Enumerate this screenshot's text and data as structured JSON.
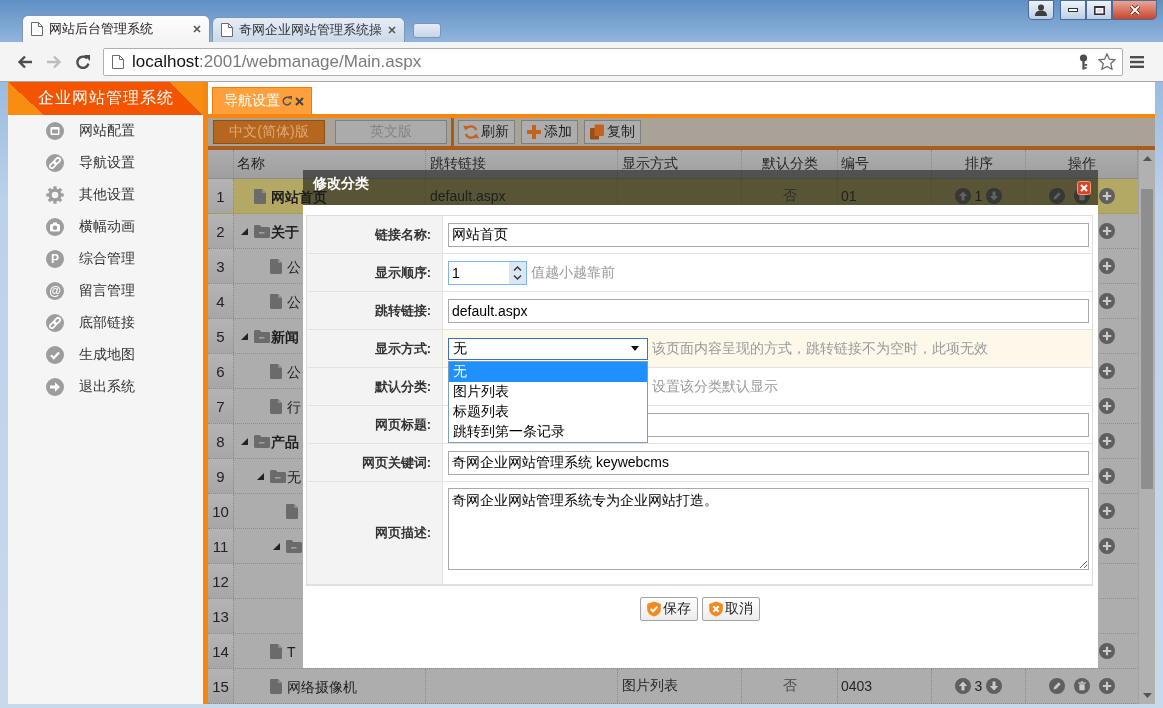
{
  "browser": {
    "tabs": [
      {
        "title": "网站后台管理系统",
        "selected": true
      },
      {
        "title": "奇网企业网站管理系统操",
        "selected": false
      }
    ],
    "nav": [
      {
        "kind": "back",
        "disabled": false
      },
      {
        "kind": "forward",
        "disabled": true
      },
      {
        "kind": "reload",
        "disabled": false
      }
    ],
    "address": {
      "host": "localhost",
      "path": ":2001/webmanage/Main.aspx"
    }
  },
  "sidebar": {
    "title": "企业网站管理系统",
    "items": [
      {
        "label": "网站配置",
        "kind": "window"
      },
      {
        "label": "导航设置",
        "kind": "link"
      },
      {
        "label": "其他设置",
        "kind": "gear"
      },
      {
        "label": "横幅动画",
        "kind": "camera"
      },
      {
        "label": "综合管理",
        "kind": "letter",
        "glyph": "P"
      },
      {
        "label": "留言管理",
        "kind": "at",
        "glyph": "@"
      },
      {
        "label": "底部链接",
        "kind": "link"
      },
      {
        "label": "生成地图",
        "kind": "check"
      },
      {
        "label": "退出系统",
        "kind": "arrow"
      }
    ]
  },
  "page_tabs": [
    {
      "label": "导航设置",
      "selected": true
    }
  ],
  "toolbar": {
    "languages": [
      {
        "label": "中文(简体)版",
        "selected": true
      },
      {
        "label": "英文版",
        "selected": false
      }
    ],
    "buttons": [
      {
        "label": "刷新",
        "kind": "refresh"
      },
      {
        "label": "添加",
        "kind": "add"
      },
      {
        "label": "复制",
        "kind": "copy"
      }
    ]
  },
  "table": {
    "columns": [
      "名称",
      "跳转链接",
      "显示方式",
      "默认分类",
      "编号",
      "排序",
      "操作"
    ],
    "rows": [
      {
        "number": "1",
        "kind": "file",
        "name": "网站首页",
        "selected": true,
        "link": "default.aspx",
        "default": "否",
        "code": "01",
        "order": "1",
        "actions": [
          {
            "kind": "edit"
          },
          {
            "kind": "delete"
          },
          {
            "kind": "add"
          }
        ]
      },
      {
        "number": "2",
        "kind": "folder",
        "expanded": true,
        "name": "关于",
        "selected": false,
        "actions": [
          {
            "kind": "add"
          }
        ],
        "children": [
          {
            "number": "3",
            "kind": "file",
            "name": "公",
            "selected": false,
            "actions": [
              {
                "kind": "add"
              }
            ]
          },
          {
            "number": "4",
            "kind": "file",
            "name": "公",
            "selected": false,
            "actions": [
              {
                "kind": "add"
              }
            ]
          }
        ]
      },
      {
        "number": "5",
        "kind": "folder",
        "expanded": true,
        "name": "新闻",
        "selected": false,
        "actions": [
          {
            "kind": "add"
          }
        ],
        "children": [
          {
            "number": "6",
            "kind": "file",
            "name": "公",
            "selected": false,
            "actions": [
              {
                "kind": "add"
              }
            ]
          },
          {
            "number": "7",
            "kind": "file",
            "name": "行",
            "selected": false,
            "actions": [
              {
                "kind": "add"
              }
            ]
          }
        ]
      },
      {
        "number": "8",
        "kind": "folder",
        "expanded": true,
        "name": "产品",
        "selected": false,
        "actions": [
          {
            "kind": "add"
          }
        ],
        "children": [
          {
            "number": "9",
            "kind": "folder",
            "expanded": true,
            "name": "无",
            "selected": false,
            "actions": [
              {
                "kind": "add"
              }
            ],
            "children": [
              {
                "number": "10",
                "kind": "file",
                "selected": false,
                "actions": [
                  {
                    "kind": "add"
                  }
                ]
              },
              {
                "number": "11",
                "kind": "folder",
                "expanded": true,
                "selected": false,
                "actions": [
                  {
                    "kind": "add"
                  }
                ],
                "children": [
                  {
                    "number": "12",
                    "selected": false
                  },
                  {
                    "number": "13",
                    "selected": false
                  }
                ]
              }
            ]
          },
          {
            "number": "14",
            "kind": "file",
            "name": "T",
            "selected": false,
            "actions": [
              {
                "kind": "add"
              }
            ]
          },
          {
            "number": "15",
            "kind": "file",
            "name": "网络摄像机",
            "selected": false,
            "mode": "图片列表",
            "default": "否",
            "code": "0403",
            "order": "3",
            "actions": [
              {
                "kind": "edit"
              },
              {
                "kind": "delete"
              },
              {
                "kind": "add"
              }
            ]
          }
        ]
      }
    ]
  },
  "dialog": {
    "title": "修改分类",
    "fields": [
      {
        "label": "链接名称:",
        "kind": "text",
        "value": "网站首页",
        "focused": false
      },
      {
        "label": "显示顺序:",
        "kind": "number",
        "value": "1",
        "hint": "值越小越靠前",
        "focused": false
      },
      {
        "label": "跳转链接:",
        "kind": "text",
        "value": "default.aspx",
        "focused": false
      },
      {
        "label": "显示方式:",
        "kind": "select",
        "value": "无",
        "expanded": true,
        "hint": "该页面内容呈现的方式，跳转链接不为空时，此项无效",
        "focused": true,
        "options": [
          {
            "label": "无",
            "selected": true
          },
          {
            "label": "图片列表",
            "selected": false
          },
          {
            "label": "标题列表",
            "selected": false
          },
          {
            "label": "跳转到第一条记录",
            "selected": false
          }
        ]
      },
      {
        "label": "默认分类:",
        "kind": "covered",
        "hint": "设置该分类默认显示",
        "focused": false
      },
      {
        "label": "网页标题:",
        "kind": "text",
        "focused": false
      },
      {
        "label": "网页关键词:",
        "kind": "text",
        "value": "奇网企业网站管理系统 keywebcms",
        "focused": false
      },
      {
        "label": "网页描述:",
        "kind": "textarea",
        "value": "奇网企业网站管理系统专为企业网站打造。",
        "focused": false
      }
    ],
    "buttons": [
      {
        "label": "保存",
        "kind": "save"
      },
      {
        "label": "取消",
        "kind": "cancel"
      }
    ]
  }
}
